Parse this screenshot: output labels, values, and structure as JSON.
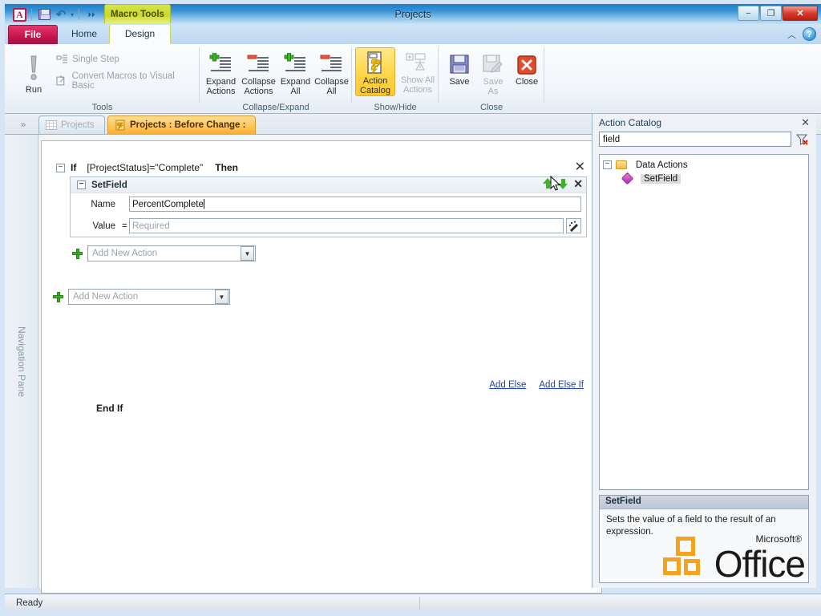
{
  "window": {
    "title": "Projects",
    "contextual_tools_label": "Macro Tools",
    "minimize": "−",
    "maximize": "❐",
    "close": "✕"
  },
  "quick_access": {
    "app_logo": "A",
    "save": "save-icon",
    "undo": "↷",
    "dropdown": "▾",
    "more": "⏵⏵"
  },
  "ribbon_help": {
    "collapse": "︿",
    "help": "?"
  },
  "tabs": [
    {
      "label": "File",
      "state": "file"
    },
    {
      "label": "Home",
      "state": "inactive"
    },
    {
      "label": "Design",
      "state": "active"
    }
  ],
  "ribbon": {
    "groups": [
      {
        "label": "Tools",
        "big_buttons": [
          {
            "label": "Run",
            "icon": "exclamation-icon",
            "enabled": true
          }
        ],
        "small_buttons": [
          {
            "label": "Single Step",
            "icon": "single-step-icon",
            "enabled": false
          },
          {
            "label": "Convert Macros to Visual Basic",
            "icon": "convert-macros-icon",
            "enabled": false
          }
        ]
      },
      {
        "label": "Collapse/Expand",
        "big_buttons": [
          {
            "label": "Expand\nActions",
            "label1": "Expand",
            "label2": "Actions",
            "icon": "expand-actions-icon"
          },
          {
            "label1": "Collapse",
            "label2": "Actions",
            "icon": "collapse-actions-icon"
          },
          {
            "label1": "Expand",
            "label2": "All",
            "icon": "expand-all-icon"
          },
          {
            "label1": "Collapse",
            "label2": "All",
            "icon": "collapse-all-icon"
          }
        ]
      },
      {
        "label": "Show/Hide",
        "big_buttons": [
          {
            "label1": "Action",
            "label2": "Catalog",
            "icon": "action-catalog-icon",
            "active": true
          },
          {
            "label1": "Show All",
            "label2": "Actions",
            "icon": "show-all-actions-icon",
            "enabled": false
          }
        ]
      },
      {
        "label": "Close",
        "big_buttons": [
          {
            "label1": "Save",
            "label2": "",
            "icon": "save-icon"
          },
          {
            "label1": "Save",
            "label2": "As",
            "icon": "save-as-icon",
            "enabled": false
          },
          {
            "label1": "Close",
            "label2": "",
            "icon": "close-red-icon"
          }
        ]
      }
    ]
  },
  "document_tabs": {
    "expand_nav": "»",
    "items": [
      {
        "label": "Projects",
        "icon": "table-icon",
        "active": false
      },
      {
        "label": "Projects : Before Change :",
        "icon": "macro-icon",
        "active": true
      }
    ],
    "close_label": "✕"
  },
  "navigation_pane": {
    "label": "Navigation Pane"
  },
  "macro_designer": {
    "if_statement": {
      "expander": "−",
      "keyword_if": "If",
      "condition": "[ProjectStatus]=\"Complete\"",
      "keyword_then": "Then",
      "close": "✕"
    },
    "action": {
      "expander": "−",
      "name": "SetField",
      "move_up": "move-up-arrow",
      "move_down": "move-down-arrow",
      "close": "✕",
      "arguments": [
        {
          "label": "Name",
          "equals": "",
          "value": "PercentComplete",
          "placeholder": "",
          "is_placeholder": false,
          "has_builder": false
        },
        {
          "label": "Value",
          "equals": "=",
          "value": "",
          "placeholder": "Required",
          "is_placeholder": true,
          "has_builder": true,
          "builder_icon": "expression-builder-icon"
        }
      ]
    },
    "add_action_inner": {
      "icon": "plus-icon",
      "placeholder": "Add New Action",
      "arrow": "▼"
    },
    "add_else": "Add Else",
    "add_else_if": "Add Else If",
    "end_if": "End If",
    "add_action_outer": {
      "icon": "plus-icon",
      "placeholder": "Add New Action",
      "arrow": "▼"
    }
  },
  "action_catalog": {
    "title": "Action Catalog",
    "close": "✕",
    "search_value": "field",
    "search_placeholder": "",
    "clear_filter_icon": "clear-filter-icon",
    "tree": [
      {
        "label": "Data Actions",
        "type": "folder",
        "expander": "−",
        "level": 0,
        "selected": false
      },
      {
        "label": "SetField",
        "type": "action",
        "level": 1,
        "selected": true
      }
    ],
    "description": {
      "title": "SetField",
      "text": "Sets the value of a field to the result of an expression."
    },
    "watermark": {
      "brand": "Office",
      "ms": "Microsoft®"
    }
  },
  "status_bar": {
    "text": "Ready"
  }
}
